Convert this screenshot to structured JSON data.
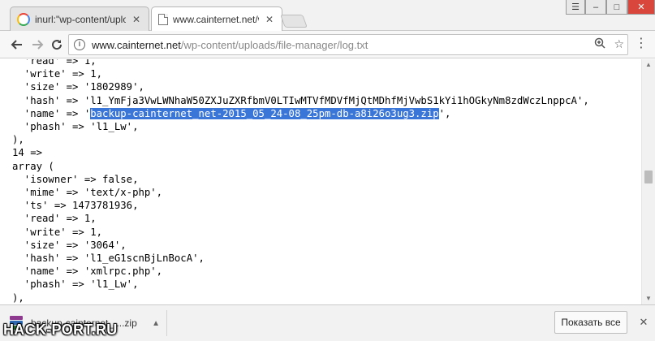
{
  "tabs": [
    {
      "title": "inurl:\"wp-content/uploads",
      "active": false,
      "icon": "google-icon"
    },
    {
      "title": "www.cainternet.net/wp-c",
      "active": true,
      "icon": "document-icon"
    }
  ],
  "window_controls": {
    "user": "☰",
    "minimize": "–",
    "maximize": "□",
    "close": "✕"
  },
  "address_bar": {
    "host": "www.cainternet.net",
    "path": "/wp-content/uploads/file-manager/log.txt"
  },
  "code_lines": {
    "l01": "  'read' => 1,",
    "l02": "  'write' => 1,",
    "l03": "  'size' => '1802989',",
    "l04": "  'hash' => 'l1_YmFja3VwLWNhaW50ZXJuZXRfbmV0LTIwMTVfMDVfMjQtMDhfMjVwbS1kYi1hOGkyNm8zdWczLnppcA',",
    "l05_pre": "  'name' => '",
    "l05_sel": "backup-cainternet_net-2015_05_24-08_25pm-db-a8i26o3ug3.zip",
    "l05_post": "',",
    "l06": "  'phash' => 'l1_Lw',",
    "l07": "),",
    "l08": "14 =>",
    "l09": "array (",
    "l10": "  'isowner' => false,",
    "l11": "  'mime' => 'text/x-php',",
    "l12": "  'ts' => 1473781936,",
    "l13": "  'read' => 1,",
    "l14": "  'write' => 1,",
    "l15": "  'size' => '3064',",
    "l16": "  'hash' => 'l1_eG1scnBjLnBocA',",
    "l17": "  'name' => 'xmlrpc.php',",
    "l18": "  'phash' => 'l1_Lw',",
    "l19": "),"
  },
  "downloads": {
    "file_name": "backup-cainternet_....zip",
    "show_all": "Показать все"
  },
  "watermark": "HACK-PORT.RU"
}
